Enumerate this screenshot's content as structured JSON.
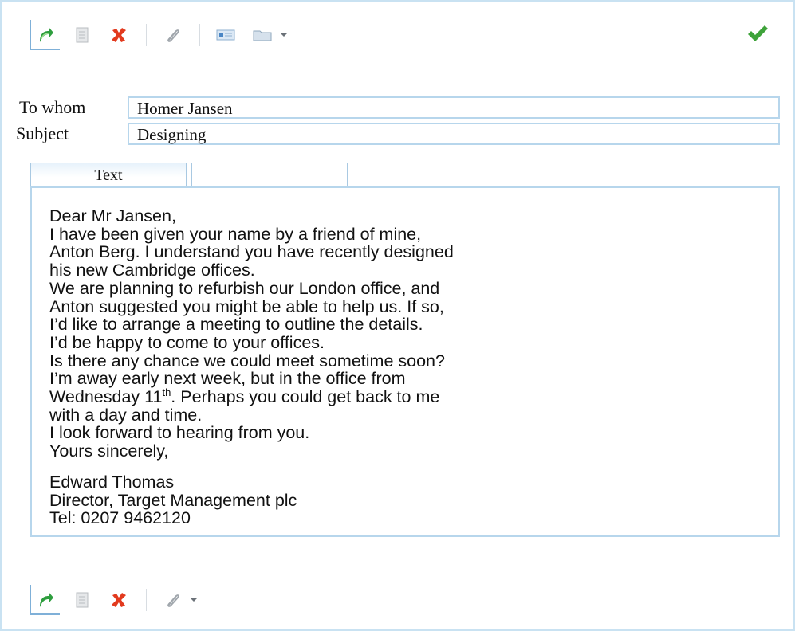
{
  "toolbar_top": {
    "buttons": [
      {
        "name": "send-icon",
        "color": "#2e9e3e"
      },
      {
        "name": "document-icon",
        "color": "#9aa0a6"
      },
      {
        "name": "delete-icon",
        "color": "#e23a1e"
      },
      {
        "name": "attach-icon",
        "color": "#a0a6ac"
      },
      {
        "name": "address-card-icon",
        "color": "#4a86c5"
      },
      {
        "name": "folder-icon",
        "color": "#8fa7bd"
      }
    ],
    "confirm_icon": "checkmark-icon",
    "confirm_color": "#3ea33a"
  },
  "form": {
    "to_label": "To whom",
    "to_value": "Homer Jansen",
    "subject_label": "Subject",
    "subject_value": "Designing"
  },
  "tabs": [
    {
      "label": "Text",
      "active": true
    },
    {
      "label": "",
      "active": false
    }
  ],
  "message": {
    "lines": [
      "Dear Mr Jansen,",
      "I have been given your name by a friend of mine,",
      "Anton Berg. I understand you have recently designed",
      "his new Cambridge offices.",
      "We are planning to refurbish our London office, and",
      "Anton suggested you might be able to help us. If so,",
      "I’d like to arrange a meeting to outline the details.",
      "I’d be happy to come to your offices.",
      "Is there any chance we could meet sometime soon?",
      "I’m away early next week, but in the office from"
    ],
    "wednesday_prefix": "Wednesday 11",
    "wednesday_sup": "th",
    "wednesday_suffix": ". Perhaps you could get back to me",
    "lines_after": [
      "with a day and time.",
      "I look forward to hearing from you.",
      "Yours sincerely,"
    ],
    "signature": [
      "Edward Thomas",
      "Director, Target Management plc",
      "Tel: 0207 9462120"
    ]
  }
}
